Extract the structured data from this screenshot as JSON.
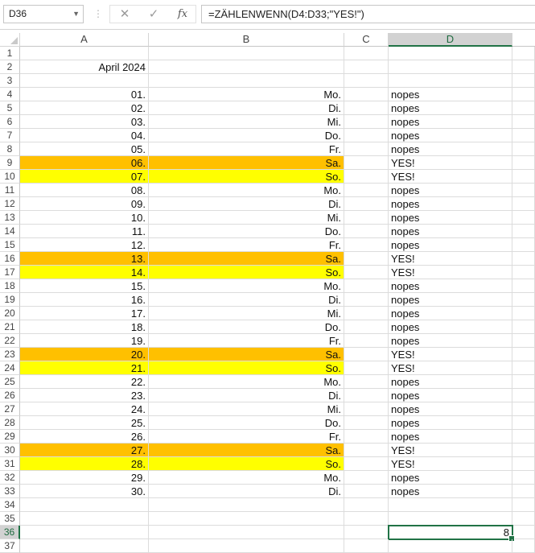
{
  "formula_bar": {
    "name_box": "D36",
    "cancel_icon": "✕",
    "enter_icon": "✓",
    "fx_label": "fx",
    "formula": "=ZÄHLENWENN(D4:D33;\"YES!\")"
  },
  "columns": [
    "A",
    "B",
    "C",
    "D"
  ],
  "selected_column": "D",
  "selected_row": "36",
  "colors": {
    "saturday_fill": "#ffc000",
    "sunday_fill": "#ffff00",
    "selection_accent": "#217346"
  },
  "rows": [
    {
      "num": "1",
      "a": "",
      "b": "",
      "d": "",
      "fill": ""
    },
    {
      "num": "2",
      "a": "April 2024",
      "b": "",
      "d": "",
      "fill": ""
    },
    {
      "num": "3",
      "a": "",
      "b": "",
      "d": "",
      "fill": ""
    },
    {
      "num": "4",
      "a": "01.",
      "b": "Mo.",
      "d": "nopes",
      "fill": ""
    },
    {
      "num": "5",
      "a": "02.",
      "b": "Di.",
      "d": "nopes",
      "fill": ""
    },
    {
      "num": "6",
      "a": "03.",
      "b": "Mi.",
      "d": "nopes",
      "fill": ""
    },
    {
      "num": "7",
      "a": "04.",
      "b": "Do.",
      "d": "nopes",
      "fill": ""
    },
    {
      "num": "8",
      "a": "05.",
      "b": "Fr.",
      "d": "nopes",
      "fill": ""
    },
    {
      "num": "9",
      "a": "06.",
      "b": "Sa.",
      "d": "YES!",
      "fill": "orange"
    },
    {
      "num": "10",
      "a": "07.",
      "b": "So.",
      "d": "YES!",
      "fill": "yellow"
    },
    {
      "num": "11",
      "a": "08.",
      "b": "Mo.",
      "d": "nopes",
      "fill": ""
    },
    {
      "num": "12",
      "a": "09.",
      "b": "Di.",
      "d": "nopes",
      "fill": ""
    },
    {
      "num": "13",
      "a": "10.",
      "b": "Mi.",
      "d": "nopes",
      "fill": ""
    },
    {
      "num": "14",
      "a": "11.",
      "b": "Do.",
      "d": "nopes",
      "fill": ""
    },
    {
      "num": "15",
      "a": "12.",
      "b": "Fr.",
      "d": "nopes",
      "fill": ""
    },
    {
      "num": "16",
      "a": "13.",
      "b": "Sa.",
      "d": "YES!",
      "fill": "orange"
    },
    {
      "num": "17",
      "a": "14.",
      "b": "So.",
      "d": "YES!",
      "fill": "yellow"
    },
    {
      "num": "18",
      "a": "15.",
      "b": "Mo.",
      "d": "nopes",
      "fill": ""
    },
    {
      "num": "19",
      "a": "16.",
      "b": "Di.",
      "d": "nopes",
      "fill": ""
    },
    {
      "num": "20",
      "a": "17.",
      "b": "Mi.",
      "d": "nopes",
      "fill": ""
    },
    {
      "num": "21",
      "a": "18.",
      "b": "Do.",
      "d": "nopes",
      "fill": ""
    },
    {
      "num": "22",
      "a": "19.",
      "b": "Fr.",
      "d": "nopes",
      "fill": ""
    },
    {
      "num": "23",
      "a": "20.",
      "b": "Sa.",
      "d": "YES!",
      "fill": "orange"
    },
    {
      "num": "24",
      "a": "21.",
      "b": "So.",
      "d": "YES!",
      "fill": "yellow"
    },
    {
      "num": "25",
      "a": "22.",
      "b": "Mo.",
      "d": "nopes",
      "fill": ""
    },
    {
      "num": "26",
      "a": "23.",
      "b": "Di.",
      "d": "nopes",
      "fill": ""
    },
    {
      "num": "27",
      "a": "24.",
      "b": "Mi.",
      "d": "nopes",
      "fill": ""
    },
    {
      "num": "28",
      "a": "25.",
      "b": "Do.",
      "d": "nopes",
      "fill": ""
    },
    {
      "num": "29",
      "a": "26.",
      "b": "Fr.",
      "d": "nopes",
      "fill": ""
    },
    {
      "num": "30",
      "a": "27.",
      "b": "Sa.",
      "d": "YES!",
      "fill": "orange"
    },
    {
      "num": "31",
      "a": "28.",
      "b": "So.",
      "d": "YES!",
      "fill": "yellow"
    },
    {
      "num": "32",
      "a": "29.",
      "b": "Mo.",
      "d": "nopes",
      "fill": ""
    },
    {
      "num": "33",
      "a": "30.",
      "b": "Di.",
      "d": "nopes",
      "fill": ""
    },
    {
      "num": "34",
      "a": "",
      "b": "",
      "d": "",
      "fill": ""
    },
    {
      "num": "35",
      "a": "",
      "b": "",
      "d": "",
      "fill": ""
    },
    {
      "num": "36",
      "a": "",
      "b": "",
      "d": "8",
      "fill": ""
    },
    {
      "num": "37",
      "a": "",
      "b": "",
      "d": "",
      "fill": ""
    }
  ]
}
